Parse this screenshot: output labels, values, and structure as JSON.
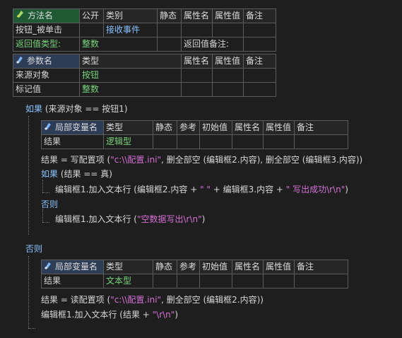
{
  "method_table": {
    "headers": [
      "方法名",
      "公开",
      "类别",
      "静态",
      "属性名",
      "属性值",
      "备注"
    ],
    "row": {
      "name": "按钮_被单击",
      "public": "",
      "category": "接收事件",
      "static": "",
      "prop_name": "",
      "prop_value": "",
      "note": ""
    },
    "return_type_label": "返回值类型:",
    "return_type_value": "整数",
    "return_note_label": "返回值备注:",
    "return_note_value": ""
  },
  "param_table": {
    "headers": [
      "参数名",
      "类型",
      "属性名",
      "属性值",
      "备注"
    ],
    "rows": [
      {
        "name": "来源对象",
        "type": "按钮"
      },
      {
        "name": "标记值",
        "type": "整数"
      }
    ]
  },
  "code": {
    "if1": {
      "keyword": "如果",
      "cond": "(来源对象 == 按钮1)"
    },
    "local_table_headers": [
      "局部变量名",
      "类型",
      "静态",
      "参考",
      "初始值",
      "属性名",
      "属性值",
      "备注"
    ],
    "local1": {
      "name": "结果",
      "type": "逻辑型"
    },
    "stmt1": {
      "lhs": "结果 = 写配置项 (",
      "s1": "\"c:\\\\配置.ini\"",
      "mid": ", 删全部空 (编辑框2.内容), 删全部空 (编辑框3.内容))"
    },
    "if2": {
      "keyword": "如果",
      "cond": "(结果 == 真)"
    },
    "stmt2": {
      "a": "编辑框1.加入文本行 (编辑框2.内容 + ",
      "s1": "\" \"",
      "b": " + 编辑框3.内容 + ",
      "s2": "\"  写出成功\\r\\n\"",
      "c": ")"
    },
    "else1": "否则",
    "stmt3": {
      "a": "编辑框1.加入文本行 (",
      "s1": "\"空数据写出\\r\\n\"",
      "b": ")"
    },
    "else2": "否则",
    "local2": {
      "name": "结果",
      "type": "文本型"
    },
    "stmt4": {
      "a": "结果 = 读配置项 (",
      "s1": "\"c:\\\\配置.ini\"",
      "b": ", 删全部空 (编辑框2.内容))"
    },
    "stmt5": {
      "a": "编辑框1.加入文本行 (结果 + ",
      "s1": "\"\\r\\n\"",
      "b": ")"
    }
  },
  "colors": {
    "background": "#1e1e1e",
    "keyword": "#8ac3ff",
    "type": "#79d27c",
    "string": "#d670d6",
    "grid": "#5c5c5c"
  }
}
